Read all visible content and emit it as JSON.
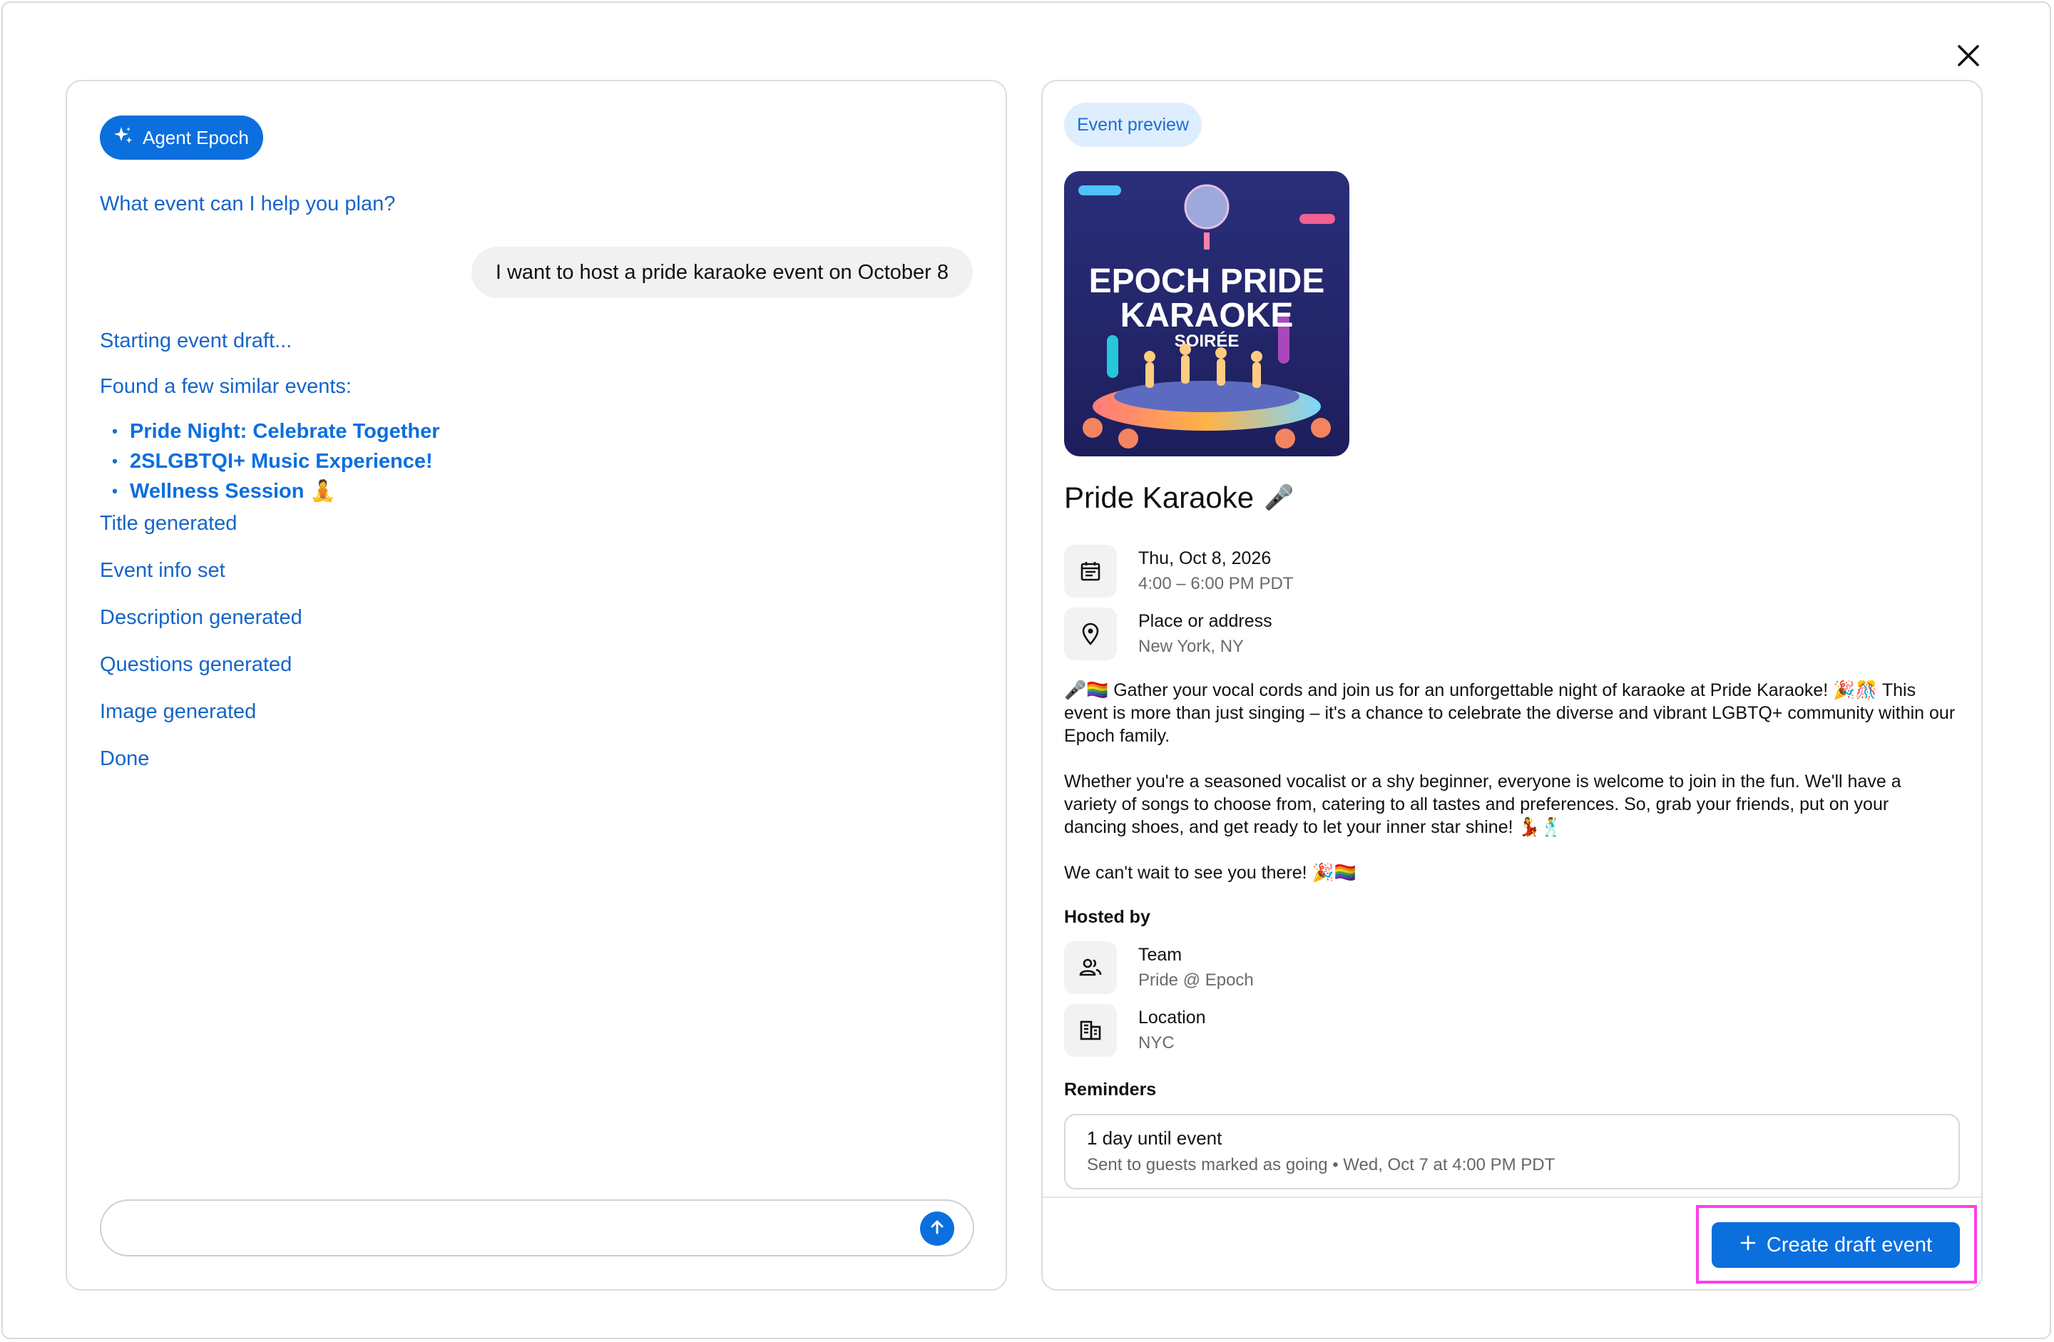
{
  "window": {
    "close_icon": "close-icon"
  },
  "chat": {
    "agent_name": "Agent Epoch",
    "prompt": "What event can I help you plan?",
    "user_message": "I want to host a pride karaoke event on October 8",
    "status_starting": "Starting event draft...",
    "status_found": "Found a few similar events:",
    "similar_events": [
      {
        "label": "Pride Night: Celebrate Together"
      },
      {
        "label": "2SLGBTQI+ Music Experience!"
      },
      {
        "label": "Wellness Session 🧘"
      }
    ],
    "status_title": "Title generated",
    "status_info": "Event info set",
    "status_description": "Description generated",
    "status_questions": "Questions generated",
    "status_image": "Image generated",
    "status_done": "Done",
    "input_value": "",
    "send_icon": "arrow-up-icon"
  },
  "preview": {
    "pill": "Event preview",
    "image_text": {
      "line1": "EPOCH PRIDE",
      "line2": "KARAOKE",
      "line3": "SOIRÉE"
    },
    "title": "Pride Karaoke",
    "title_emoji": "🎤",
    "date": {
      "primary": "Thu, Oct 8, 2026",
      "secondary": "4:00 – 6:00 PM PDT",
      "icon": "calendar-icon"
    },
    "place": {
      "primary": "Place or address",
      "secondary": "New York, NY",
      "icon": "location-pin-icon"
    },
    "description": [
      "🎤🏳️‍🌈 Gather your vocal cords and join us for an unforgettable night of karaoke at Pride Karaoke! 🎉🎊 This event is more than just singing – it's a chance to celebrate the diverse and vibrant LGBTQ+ community within our Epoch family.",
      "Whether you're a seasoned vocalist or a shy beginner, everyone is welcome to join in the fun. We'll have a variety of songs to choose from, catering to all tastes and preferences. So, grab your friends, put on your dancing shoes, and get ready to let your inner star shine! 💃🕺",
      "We can't wait to see you there! 🎉🏳️‍🌈"
    ],
    "hosted_by_label": "Hosted by",
    "team": {
      "primary": "Team",
      "secondary": "Pride @ Epoch",
      "icon": "group-icon"
    },
    "location": {
      "primary": "Location",
      "secondary": "NYC",
      "icon": "building-icon"
    },
    "reminders_label": "Reminders",
    "reminder": {
      "title": "1 day until event",
      "subtitle": "Sent to guests marked as going • Wed, Oct 7 at 4:00 PM PDT"
    },
    "create_button": "Create draft event",
    "accent_color": "#0b6fde"
  }
}
